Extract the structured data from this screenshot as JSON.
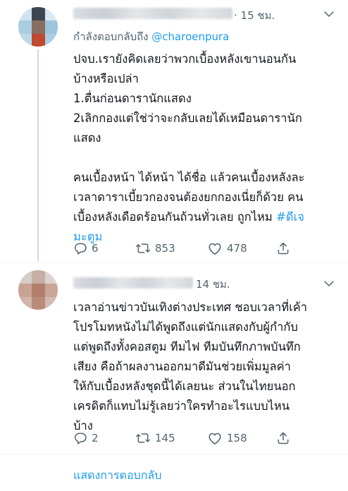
{
  "tweets": [
    {
      "time": "· 15 ชม.",
      "replying_prefix": "กำลังตอบกลับถึง",
      "replying_handle": "@charoenpura",
      "lines": [
        "ปจบ.เรายังคิดเลยว่าพวกเบื้องหลังเขานอนกัน",
        "บ้างหรือเปล่า",
        "1.ตื่นก่อนดารานักแสดง",
        "2เลิกกองแต่ใช่ว่าจะกลับเลยได้เหมือนดารานัก",
        "แสดง",
        "",
        "คนเบื้องหน้า ได้หน้า ได้ชื่อ แล้วคนเบื้องหลังละ",
        "เวลาดาราเบี้ยวกองจนต้องยกกองเนี่ยก็ด้วย คน",
        "เบื้องหลังเดือดร้อนกันถ้วนทั่วเลย ถูกไหม ",
        "มะตูม"
      ],
      "hashtag_part1": "#ดีเจ",
      "replies": "6",
      "retweets": "853",
      "likes": "478"
    },
    {
      "time": "14 ชม.",
      "lines": [
        "เวลาอ่านข่าวบันเทิงต่างประเทศ ชอบเวลาที่เค้า",
        "โปรโมทหนังไม่ได้พูดถึงแต่นักแสดงกับผู้กำกับ",
        "แต่พูดถึงทั้งคอสตูม ทีมไฟ ทีมบันทึกภาพบันทึก",
        "เสียง คือถ้าผลงานออกมาดีมันช่วยเพิ่มมูลค่า",
        "ให้กับเบื้องหลังชุดนี้ได้เลยนะ ส่วนในไทยนอก",
        "เครดิตก็แทบไม่รู้เลยว่าใครทำอะไรแบบไหน",
        "บ้าง"
      ],
      "replies": "2",
      "retweets": "145",
      "likes": "158"
    }
  ],
  "show_replies_label": "แสดงการตอบกลับ",
  "colors": {
    "accent": "#1d9bf0",
    "secondary_text": "#536471",
    "text": "#0f1419",
    "divider": "#eff3f4"
  },
  "icons": [
    "reply-icon",
    "retweet-icon",
    "like-icon",
    "share-icon",
    "more-chevron-icon"
  ]
}
